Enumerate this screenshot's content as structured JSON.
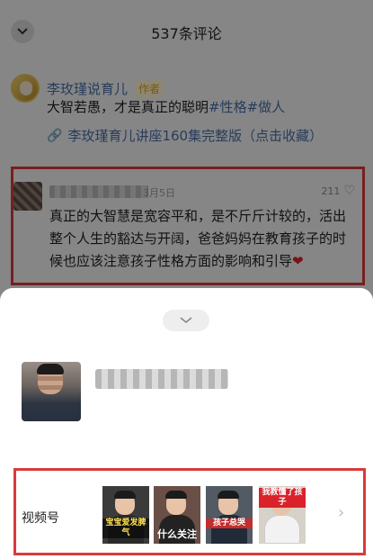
{
  "header": {
    "title": "537条评论",
    "collapse_icon": "chevron-down-icon"
  },
  "post": {
    "author_name": "李玫瑾说育儿",
    "author_tag": "作者",
    "text_plain": "大智若愚，才是真正的聪明",
    "hashtags": "#性格#做人",
    "link_text": "李玫瑾育儿讲座160集完整版（点击收藏）",
    "link_icon": "link-icon"
  },
  "comment": {
    "date": "3月5日",
    "likes": "211",
    "text": "真正的大智慧是宽容平和，是不斤斤计较的，活出整个人生的豁达与开阔，爸爸妈妈在教育孩子的时候也应该注意孩子性格方面的影响和引导",
    "emoji": "❤"
  },
  "sheet": {
    "handle_icon": "chevron-down-icon",
    "channel_label": "视频号",
    "thumbnails": [
      {
        "caption": "宝宝爱发脾气"
      },
      {
        "caption": "什么关注"
      },
      {
        "caption": "孩子总哭"
      },
      {
        "caption": "我教懂了孩子"
      }
    ],
    "more_icon": "chevron-right-icon"
  },
  "colors": {
    "highlight_border": "#d93a3a",
    "link_blue": "#4a6ea8",
    "author_tag": "#e1a500"
  }
}
